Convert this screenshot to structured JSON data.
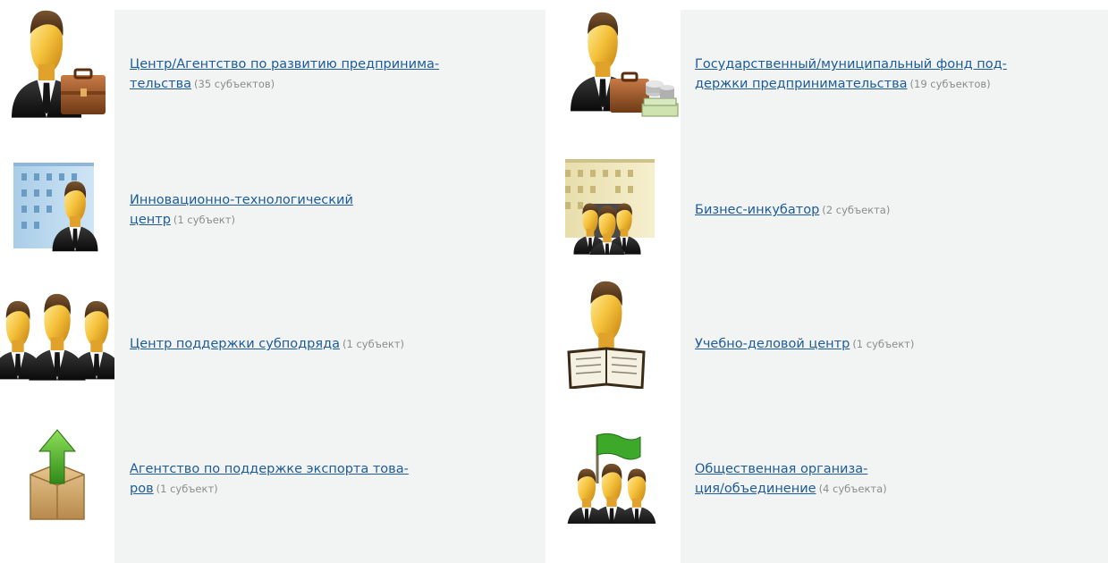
{
  "items": [
    {
      "lines": [
        "Центр/Агентство по развитию предпринима-",
        "тельства"
      ],
      "count": "(35 субъектов)",
      "icon": "businessman-briefcase-icon"
    },
    {
      "lines": [
        "Государственный/муниципальный фонд под-",
        "держки предпринимательства"
      ],
      "count": "(19 субъектов)",
      "icon": "businessman-money-icon"
    },
    {
      "lines": [
        "Инновационно-технологический",
        "центр"
      ],
      "count": "(1 субъект)",
      "icon": "office-building-businessman-icon"
    },
    {
      "lines": [
        "Бизнес-инкубатор"
      ],
      "count": "(2 субъекта)",
      "icon": "building-people-icon"
    },
    {
      "lines": [
        "Центр поддержки субподряда"
      ],
      "count": "(1 субъект)",
      "icon": "three-businessmen-icon"
    },
    {
      "lines": [
        "Учебно-деловой центр"
      ],
      "count": "(1 субъект)",
      "icon": "businessman-book-icon"
    },
    {
      "lines": [
        "Агентство по поддержке экспорта това-",
        "ров"
      ],
      "count": "(1 субъект)",
      "icon": "box-upload-arrow-icon"
    },
    {
      "lines": [
        "Общественная организа-",
        "ция/объединение"
      ],
      "count": "(4 субъекта)",
      "icon": "group-flag-icon"
    }
  ],
  "colors": {
    "link": "#1c5c9a",
    "count": "#8c8c8c",
    "panel": "#f2f3f3"
  }
}
